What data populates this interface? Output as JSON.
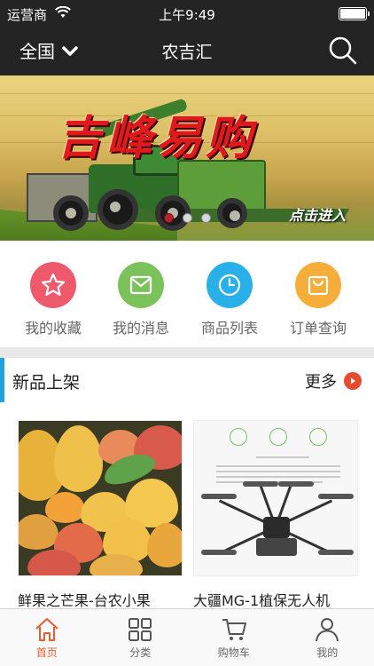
{
  "status_bar": {
    "carrier": "运营商",
    "time": "上午9:49"
  },
  "nav": {
    "region": "全国",
    "title": "农吉汇"
  },
  "banner": {
    "title": "吉峰易购",
    "cta": "点击进入",
    "slide_count": 3,
    "active_slide": 1
  },
  "quick_links": [
    {
      "label": "我的收藏",
      "icon": "star-icon",
      "color": "#ee5a6c"
    },
    {
      "label": "我的消息",
      "icon": "mail-icon",
      "color": "#7cc25a"
    },
    {
      "label": "商品列表",
      "icon": "clock-icon",
      "color": "#2ab0e8"
    },
    {
      "label": "订单查询",
      "icon": "bag-icon",
      "color": "#f6ad3a"
    }
  ],
  "new_arrivals": {
    "title": "新品上架",
    "more": "更多",
    "products": [
      {
        "name": "鲜果之芒果-台农小果"
      },
      {
        "name": "大疆MG-1植保无人机"
      }
    ]
  },
  "tabbar": {
    "items": [
      {
        "label": "首页",
        "icon": "home-icon",
        "active": true
      },
      {
        "label": "分类",
        "icon": "grid-icon",
        "active": false
      },
      {
        "label": "购物车",
        "icon": "cart-icon",
        "active": false
      },
      {
        "label": "我的",
        "icon": "user-icon",
        "active": false
      }
    ],
    "active_color": "#e85d30"
  }
}
